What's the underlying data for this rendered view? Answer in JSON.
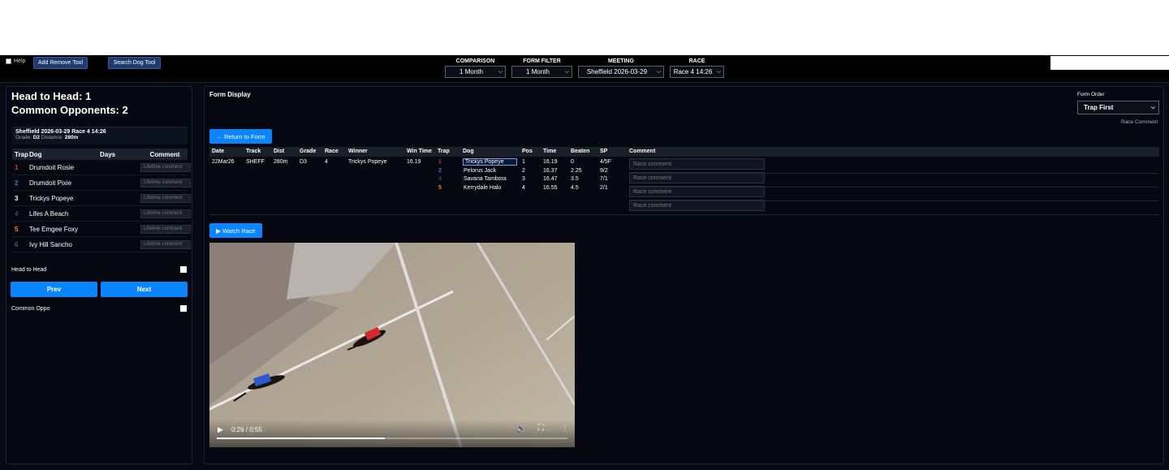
{
  "topbar": {
    "help_label": "Help",
    "add_remove_label": "Add Remove Tool",
    "search_dog_label": "Search Dog Tool",
    "comparison": {
      "label": "COMPARISON",
      "value": "1 Month"
    },
    "form_filter": {
      "label": "FORM FILTER",
      "value": "1 Month"
    },
    "meeting": {
      "label": "MEETING",
      "value": "Sheffield 2026-03-29"
    },
    "race": {
      "label": "RACE",
      "value": "Race 4 14:26"
    },
    "search_value": ""
  },
  "left": {
    "head_to_head": "Head to Head: 1",
    "common_opponents": "Common Opponents: 2",
    "race_title": "Sheffield 2026-03-29 Race 4 14:26",
    "grade_label": "Grade:",
    "grade_value": "D2",
    "distance_label": "Distance:",
    "distance_value": "280m",
    "columns": [
      "Trap",
      "Dog",
      "Days",
      "Comment"
    ],
    "comment_placeholder": "Lifetime comment",
    "dogs": [
      {
        "trap": "1",
        "trap_color": "#e03030",
        "name": "Drumdoit Rosie",
        "days": ""
      },
      {
        "trap": "2",
        "trap_color": "#3a7bd5",
        "name": "Drumdoit Pixie",
        "days": ""
      },
      {
        "trap": "3",
        "trap_color": "#ffffff",
        "name": "Trickys Popeye",
        "days": ""
      },
      {
        "trap": "4",
        "trap_color": "#444444",
        "name": "Lifes A Beach",
        "days": ""
      },
      {
        "trap": "5",
        "trap_color": "#f08a24",
        "name": "Tee Emgee Foxy",
        "days": ""
      },
      {
        "trap": "6",
        "trap_color": "#555555",
        "name": "Ivy Hill Sancho",
        "days": ""
      }
    ],
    "head_to_head_toggle": "Head to Head",
    "prev_label": "Prev",
    "next_label": "Next",
    "common_oppo_toggle": "Common Oppo"
  },
  "main": {
    "title": "Form Display",
    "form_order_label": "Form Order",
    "form_order_value": "Trap First",
    "race_comment_link": "Race Comment",
    "return_label": "← Return to Form",
    "watch_label": "▶ Watch Race",
    "columns": [
      "Date",
      "Track",
      "Dist",
      "Grade",
      "Race",
      "Winner",
      "Win Time",
      "Trap",
      "Dog",
      "Pos",
      "Time",
      "Beaten",
      "SP",
      "Comment"
    ],
    "race": {
      "date": "22Mar26",
      "track": "SHEFF",
      "dist": "280m",
      "grade": "D3",
      "race": "4",
      "winner": "Trickys Popeye",
      "win_time": "16.19"
    },
    "runners": [
      {
        "trap": "1",
        "trap_color": "#e03030",
        "dog": "Trickys Popeye",
        "pos": "1",
        "time": "16.19",
        "beaten": "0",
        "sp": "4/5F"
      },
      {
        "trap": "2",
        "trap_color": "#3a7bd5",
        "dog": "Pelorus Jack",
        "pos": "2",
        "time": "16.37",
        "beaten": "2.25",
        "sp": "9/2"
      },
      {
        "trap": "4",
        "trap_color": "#444444",
        "dog": "Savana Tambora",
        "pos": "3",
        "time": "16.47",
        "beaten": "3.5",
        "sp": "7/1"
      },
      {
        "trap": "5",
        "trap_color": "#f08a24",
        "dog": "Kerrydale Halo",
        "pos": "4",
        "time": "16.55",
        "beaten": "4.5",
        "sp": "2/1"
      }
    ],
    "race_comment_placeholder": "Race comment",
    "video": {
      "time": "0:26 / 0:55",
      "progress": 0.48
    }
  }
}
